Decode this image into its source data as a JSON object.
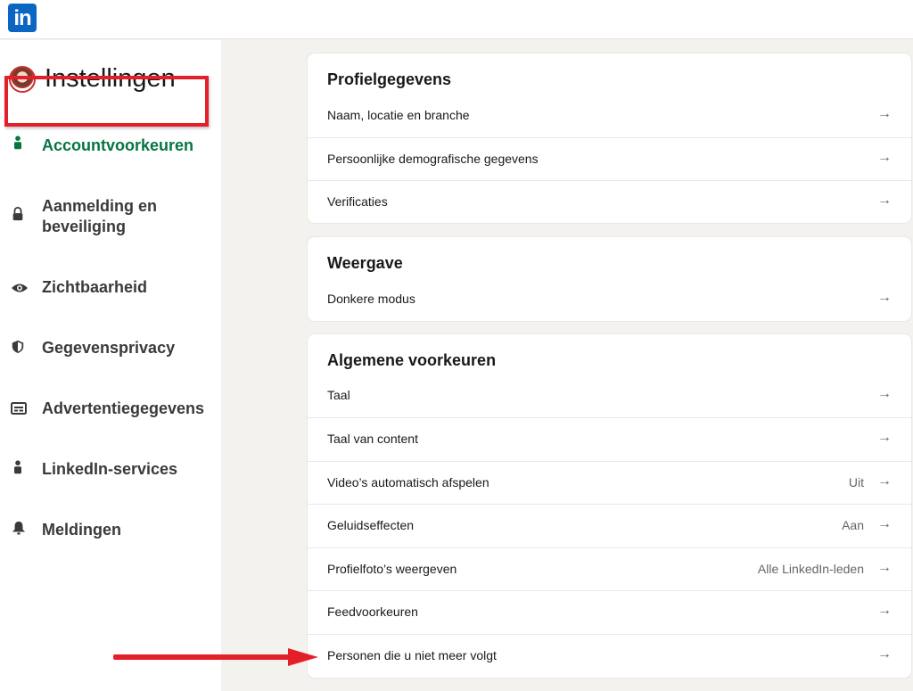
{
  "logo": {
    "text": "in"
  },
  "sidebar": {
    "title": "Instellingen",
    "items": [
      {
        "label": "Accountvoorkeuren",
        "icon": "person-icon",
        "active": true
      },
      {
        "label": "Aanmelding en beveiliging",
        "icon": "lock-icon",
        "active": false
      },
      {
        "label": "Zichtbaarheid",
        "icon": "eye-icon",
        "active": false
      },
      {
        "label": "Gegevensprivacy",
        "icon": "shield-icon",
        "active": false
      },
      {
        "label": "Advertentiegegevens",
        "icon": "ad-card-icon",
        "active": false
      },
      {
        "label": "LinkedIn-services",
        "icon": "person-icon",
        "active": false
      },
      {
        "label": "Meldingen",
        "icon": "bell-icon",
        "active": false
      }
    ]
  },
  "cards": {
    "profile": {
      "title": "Profielgegevens",
      "rows": [
        {
          "label": "Naam, locatie en branche",
          "value": ""
        },
        {
          "label": "Persoonlijke demografische gegevens",
          "value": ""
        },
        {
          "label": "Verificaties",
          "value": ""
        }
      ]
    },
    "display": {
      "title": "Weergave",
      "rows": [
        {
          "label": "Donkere modus",
          "value": ""
        }
      ]
    },
    "general": {
      "title": "Algemene voorkeuren",
      "rows": [
        {
          "label": "Taal",
          "value": ""
        },
        {
          "label": "Taal van content",
          "value": ""
        },
        {
          "label": "Video’s automatisch afspelen",
          "value": "Uit"
        },
        {
          "label": "Geluidseffecten",
          "value": "Aan"
        },
        {
          "label": "Profielfoto’s weergeven",
          "value": "Alle LinkedIn-leden"
        },
        {
          "label": "Feedvoorkeuren",
          "value": ""
        },
        {
          "label": "Personen die u niet meer volgt",
          "value": ""
        }
      ]
    }
  },
  "arrow_glyph": "→",
  "colors": {
    "accent_green": "#057642",
    "linkedin_blue": "#0a66c2",
    "highlight_red": "#e3202a"
  }
}
